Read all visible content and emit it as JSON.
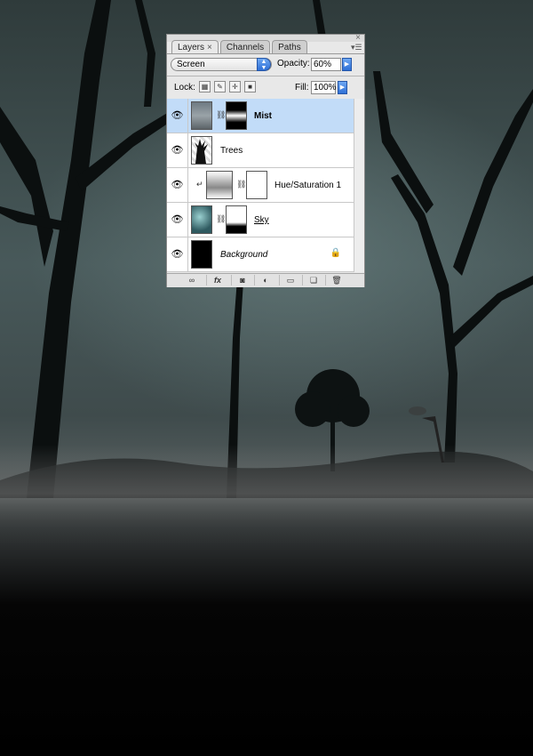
{
  "panel": {
    "tabs": [
      {
        "label": "Layers",
        "close": "×"
      },
      {
        "label": "Channels"
      },
      {
        "label": "Paths"
      }
    ],
    "blend_mode": "Screen",
    "opacity_label": "Opacity:",
    "opacity_value": "60%",
    "lock_label": "Lock:",
    "fill_label": "Fill:",
    "fill_value": "100%"
  },
  "layers": [
    {
      "name": "Mist",
      "visible": true,
      "selected": true,
      "has_mask": true
    },
    {
      "name": "Trees",
      "visible": true,
      "selected": false,
      "has_mask": false
    },
    {
      "name": "Hue/Saturation 1",
      "visible": true,
      "selected": false,
      "adjustment": true,
      "clipped": true
    },
    {
      "name": "Sky",
      "visible": true,
      "selected": false,
      "has_mask": true
    },
    {
      "name": "Background",
      "visible": true,
      "selected": false,
      "locked": true
    }
  ],
  "colors": {
    "selection": "#c2dcf8",
    "accent_blue": "#2d6fd6"
  },
  "icons": {
    "visibility": "eye-icon",
    "link": "chain-link-icon",
    "lock": "lock-icon",
    "menu": "panel-menu-icon"
  }
}
